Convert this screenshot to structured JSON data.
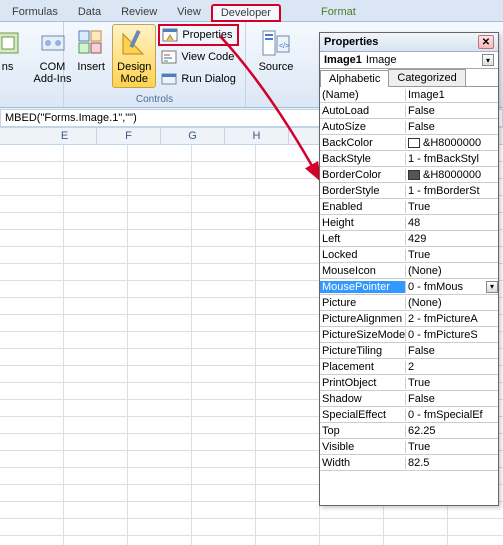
{
  "tabs": {
    "items": [
      "Formulas",
      "Data",
      "Review",
      "View",
      "Developer",
      "Format"
    ],
    "active": "Developer",
    "highlight": "Developer",
    "title_bar_hint": "Drawing Tools"
  },
  "ribbon": {
    "addins_group": {
      "label": "",
      "items": [
        {
          "label": "ns",
          "sub": ""
        },
        {
          "label": "COM\nAdd-Ins",
          "sub": ""
        }
      ]
    },
    "controls_group": {
      "label": "Controls",
      "insert": "Insert",
      "design": "Design\nMode",
      "properties": "Properties",
      "view_code": "View Code",
      "run_dialog": "Run Dialog"
    },
    "xml_group": {
      "label": "",
      "source": "Source"
    }
  },
  "formula_bar": {
    "text": "MBED(\"Forms.Image.1\",\"\")"
  },
  "columns": [
    "E",
    "F",
    "G",
    "H"
  ],
  "properties": {
    "title": "Properties",
    "object_name": "Image1",
    "object_type": "Image",
    "tabs": [
      "Alphabetic",
      "Categorized"
    ],
    "active_tab": "Alphabetic",
    "rows": [
      {
        "name": "(Name)",
        "value": "Image1"
      },
      {
        "name": "AutoLoad",
        "value": "False"
      },
      {
        "name": "AutoSize",
        "value": "False"
      },
      {
        "name": "BackColor",
        "value": "&H8000000",
        "swatch": "#ffffff"
      },
      {
        "name": "BackStyle",
        "value": "1 - fmBackStyl"
      },
      {
        "name": "BorderColor",
        "value": "&H8000000",
        "swatch": "#555555"
      },
      {
        "name": "BorderStyle",
        "value": "1 - fmBorderSt"
      },
      {
        "name": "Enabled",
        "value": "True"
      },
      {
        "name": "Height",
        "value": "48"
      },
      {
        "name": "Left",
        "value": "429"
      },
      {
        "name": "Locked",
        "value": "True"
      },
      {
        "name": "MouseIcon",
        "value": "(None)"
      },
      {
        "name": "MousePointer",
        "value": "0 - fmMous",
        "selected": true,
        "dropdown": true
      },
      {
        "name": "Picture",
        "value": "(None)"
      },
      {
        "name": "PictureAlignmen",
        "value": "2 - fmPictureA"
      },
      {
        "name": "PictureSizeMode",
        "value": "0 - fmPictureS"
      },
      {
        "name": "PictureTiling",
        "value": "False"
      },
      {
        "name": "Placement",
        "value": "2"
      },
      {
        "name": "PrintObject",
        "value": "True"
      },
      {
        "name": "Shadow",
        "value": "False"
      },
      {
        "name": "SpecialEffect",
        "value": "0 - fmSpecialEf"
      },
      {
        "name": "Top",
        "value": "62.25"
      },
      {
        "name": "Visible",
        "value": "True"
      },
      {
        "name": "Width",
        "value": "82.5"
      }
    ]
  },
  "icons": {
    "properties": "hand-properties",
    "viewcode": "code",
    "rundialog": "dialog",
    "insert": "tools",
    "design": "ruler-pencil",
    "source": "xml-source"
  }
}
